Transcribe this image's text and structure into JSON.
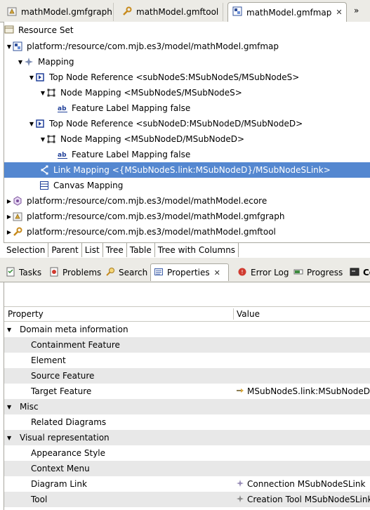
{
  "editor_tabs": [
    {
      "label": "mathModel.gmfgraph",
      "icon": "gmfgraph-icon"
    },
    {
      "label": "mathModel.gmftool",
      "icon": "wrench-icon"
    },
    {
      "label": "mathModel.gmfmap",
      "icon": "gmfmap-icon"
    }
  ],
  "editor_overflow": "»",
  "resource_set_label": "Resource Set",
  "tree": [
    {
      "label": "platform:/resource/com.mjb.es3/model/mathModel.gmfmap",
      "icon": "gmfmap-icon",
      "expanded": true
    },
    {
      "label": "Mapping",
      "icon": "mapping-icon",
      "expanded": true
    },
    {
      "label": "Top Node Reference <subNodeS:MSubNodeS/MSubNodeS>",
      "icon": "node-reference-icon",
      "expanded": true
    },
    {
      "label": "Node Mapping <MSubNodeS/MSubNodeS>",
      "icon": "node-mapping-icon",
      "expanded": true
    },
    {
      "label": "Feature Label Mapping false",
      "icon": "label-mapping-icon"
    },
    {
      "label": "Top Node Reference <subNodeD:MSubNodeD/MSubNodeD>",
      "icon": "node-reference-icon",
      "expanded": true
    },
    {
      "label": "Node Mapping <MSubNodeD/MSubNodeD>",
      "icon": "node-mapping-icon",
      "expanded": true
    },
    {
      "label": "Feature Label Mapping false",
      "icon": "label-mapping-icon"
    },
    {
      "label": "Link Mapping <{MSubNodeS.link:MSubNodeD}/MSubNodeSLink>",
      "icon": "link-mapping-icon",
      "selected": true
    },
    {
      "label": "Canvas Mapping",
      "icon": "canvas-mapping-icon"
    },
    {
      "label": "platform:/resource/com.mjb.es3/model/mathModel.ecore",
      "icon": "ecore-icon",
      "expanded": false
    },
    {
      "label": "platform:/resource/com.mjb.es3/model/mathModel.gmfgraph",
      "icon": "gmfgraph-icon",
      "expanded": false
    },
    {
      "label": "platform:/resource/com.mjb.es3/model/mathModel.gmftool",
      "icon": "wrench-icon",
      "expanded": false
    }
  ],
  "page_tabs": [
    "Selection",
    "Parent",
    "List",
    "Tree",
    "Table",
    "Tree with Columns"
  ],
  "view_tabs": [
    {
      "label": "Tasks",
      "icon": "tasks-icon"
    },
    {
      "label": "Problems",
      "icon": "problems-icon"
    },
    {
      "label": "Search",
      "icon": "search-icon"
    },
    {
      "label": "Properties",
      "icon": "properties-icon"
    },
    {
      "label": "Error Log",
      "icon": "error-log-icon"
    },
    {
      "label": "Progress",
      "icon": "progress-icon"
    },
    {
      "label": "Co",
      "icon": "console-icon"
    }
  ],
  "props": {
    "col_property": "Property",
    "col_value": "Value",
    "rows": [
      {
        "name": "Domain meta information",
        "category": true
      },
      {
        "name": "Containment Feature",
        "value": ""
      },
      {
        "name": "Element",
        "value": ""
      },
      {
        "name": "Source Feature",
        "value": ""
      },
      {
        "name": "Target Feature",
        "value": "MSubNodeS.link:MSubNodeD",
        "value_icon": "reference-icon"
      },
      {
        "name": "Misc",
        "category": true
      },
      {
        "name": "Related Diagrams",
        "value": ""
      },
      {
        "name": "Visual representation",
        "category": true
      },
      {
        "name": "Appearance Style",
        "value": ""
      },
      {
        "name": "Context Menu",
        "value": ""
      },
      {
        "name": "Diagram Link",
        "value": "Connection MSubNodeSLink",
        "value_icon": "connection-icon"
      },
      {
        "name": "Tool",
        "value": "Creation Tool MSubNodeSLink",
        "value_icon": "creation-tool-icon"
      }
    ]
  },
  "colors": {
    "selection": "#5487d0",
    "chrome": "#ecebe6",
    "border": "#a9a89f",
    "row_shade": "#e8e8e8"
  }
}
